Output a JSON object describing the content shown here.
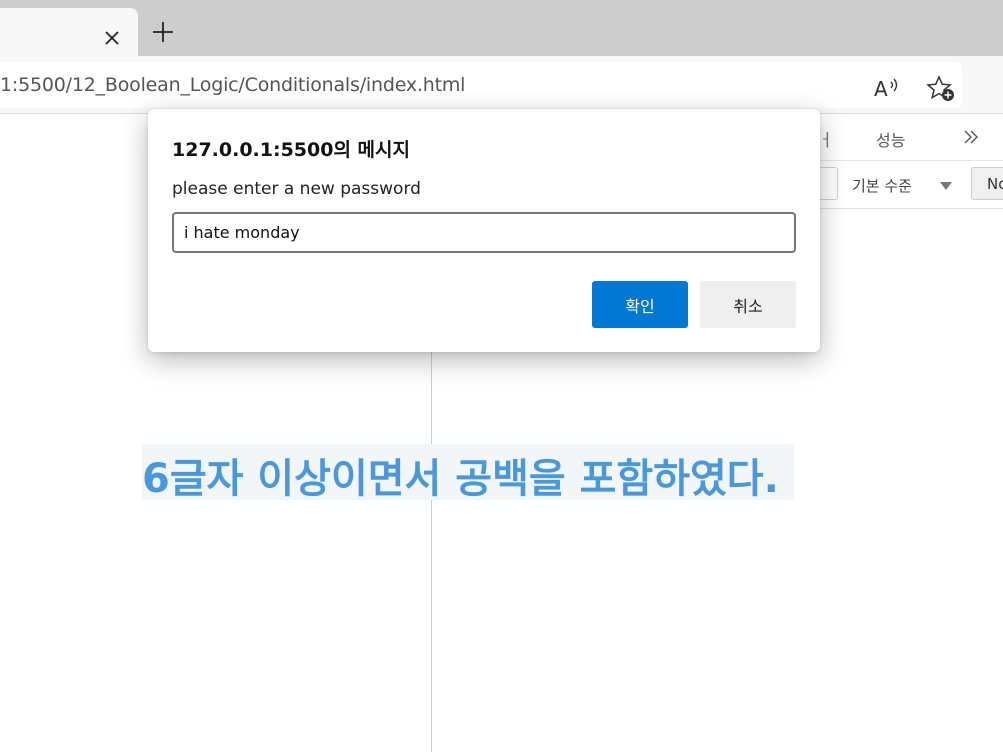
{
  "browser": {
    "url": "1:5500/12_Boolean_Logic/Conditionals/index.html",
    "tab_close_icon": "close-icon",
    "new_tab_icon": "plus-icon",
    "read_aloud_icon": "read-aloud-icon",
    "favorites_icon": "add-favorite-icon"
  },
  "devtools": {
    "partial_tab": "ㅓ",
    "performance_tab": "성능",
    "more_icon": "chevron-double-right-icon",
    "log_level": "기본 수준",
    "no_button": "No"
  },
  "page": {
    "headline": "6글자 이상이면서 공백을 포함하였다."
  },
  "dialog": {
    "title": "127.0.0.1:5500의 메시지",
    "message": "please enter a new password",
    "input_value": "i hate monday",
    "ok_label": "확인",
    "cancel_label": "취소"
  },
  "colors": {
    "accent": "#0078d4",
    "headline": "#4a98dc"
  }
}
